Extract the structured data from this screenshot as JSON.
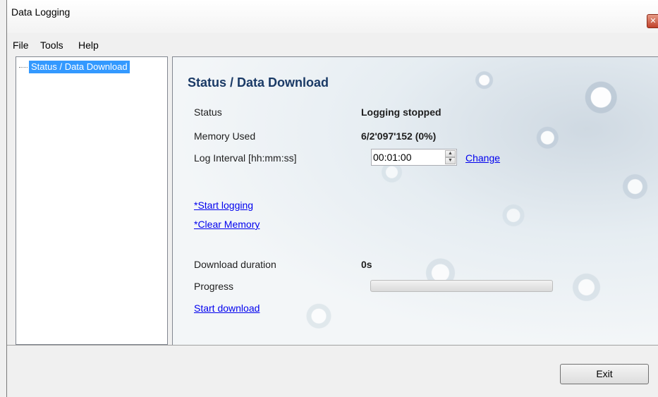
{
  "window": {
    "title": "Data Logging",
    "close_glyph": "✕"
  },
  "menu": {
    "items": [
      "File",
      "Tools",
      "Help"
    ]
  },
  "tree": {
    "nodes": [
      {
        "label": "Status / Data Download",
        "selected": true
      }
    ]
  },
  "panel": {
    "title": "Status / Data Download",
    "status_label": "Status",
    "status_value": "Logging stopped",
    "memory_label": "Memory Used",
    "memory_value": "6/2'097'152 (0%)",
    "interval_label": "Log Interval [hh:mm:ss]",
    "interval_value": "00:01:00",
    "change_link": "Change",
    "start_logging_link": "*Start logging",
    "clear_memory_link": "*Clear Memory",
    "download_duration_label": "Download duration",
    "download_duration_value": "0s",
    "progress_label": "Progress",
    "progress_percent": 0,
    "start_download_link": "Start download"
  },
  "footer": {
    "exit_label": "Exit"
  },
  "colors": {
    "title_blue": "#1a3a66",
    "link_blue": "#0000ee",
    "selection": "#3399ff"
  },
  "icons": {
    "spinner_up": "▲",
    "spinner_down": "▼"
  }
}
